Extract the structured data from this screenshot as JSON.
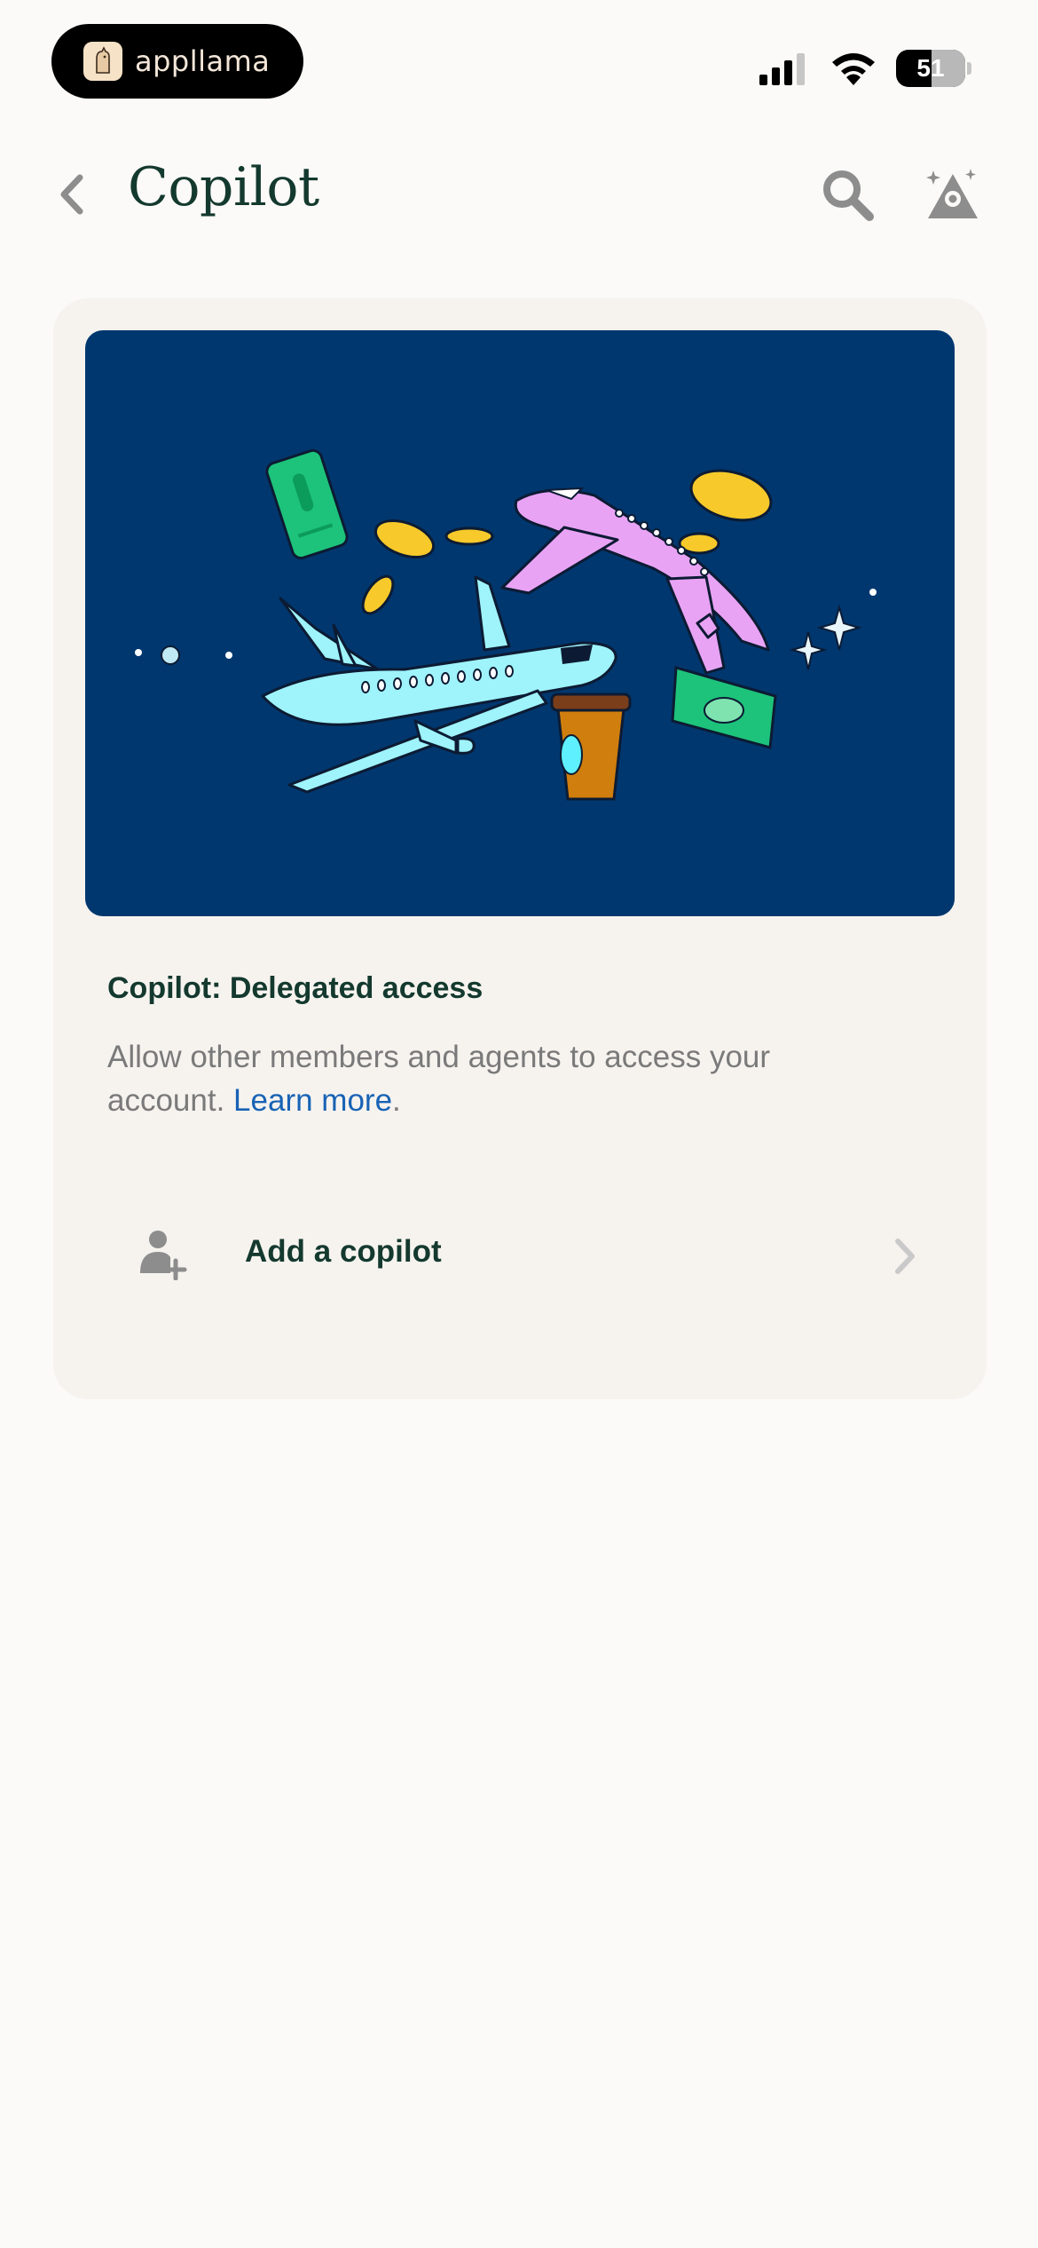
{
  "status_bar": {
    "app_name": "appllama",
    "battery": "51"
  },
  "header": {
    "title": "Copilot"
  },
  "card": {
    "title": "Copilot: Delegated access",
    "description": "Allow other members and agents to access your account.",
    "learn_more": "Learn more",
    "period": ".",
    "add_copilot_label": "Add a copilot"
  },
  "colors": {
    "background": "#fbfaf8",
    "card": "#f6f3ef",
    "hero": "#00376f",
    "heading": "#14392e",
    "link": "#1863b5",
    "muted": "#7a7a7a"
  }
}
